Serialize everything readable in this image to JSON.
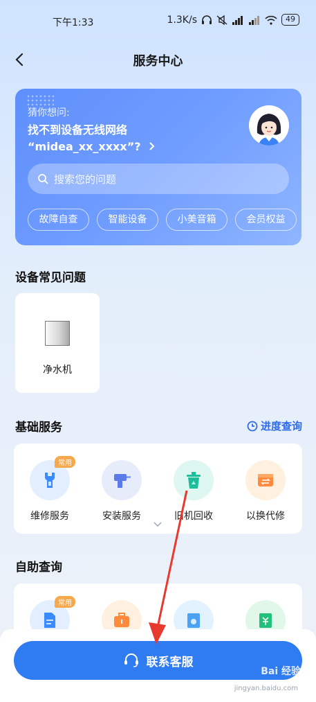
{
  "status_bar": {
    "time": "下午1:33",
    "speed": "1.3K/s",
    "battery": "49"
  },
  "header": {
    "title": "服务中心"
  },
  "hero": {
    "guess_label": "猜你想问:",
    "question_line1": "找不到设备无线网络",
    "question_line2": "“midea_xx_xxxx”?",
    "search_placeholder": "搜索您的问题",
    "chips": [
      "故障自查",
      "智能设备",
      "小美音箱",
      "会员权益"
    ]
  },
  "faq": {
    "title": "设备常见问题",
    "devices": [
      {
        "label": "净水机"
      }
    ]
  },
  "basic_services": {
    "title": "基础服务",
    "progress_link": "进度查询",
    "items": [
      {
        "label": "维修服务",
        "icon": "wrench-icon",
        "badge": "常用"
      },
      {
        "label": "安装服务",
        "icon": "drill-icon"
      },
      {
        "label": "旧机回收",
        "icon": "recycle-bin-icon"
      },
      {
        "label": "以换代修",
        "icon": "exchange-box-icon"
      }
    ]
  },
  "self_service": {
    "title": "自助查询",
    "items": [
      {
        "icon": "document-icon",
        "badge": "常用"
      },
      {
        "icon": "toolbox-icon"
      },
      {
        "icon": "part-icon"
      },
      {
        "icon": "price-icon"
      }
    ]
  },
  "contact_button": {
    "label": "联系客服"
  },
  "watermark": {
    "text": "Bai 经验",
    "sub": "jingyan.baidu.com"
  },
  "colors": {
    "primary": "#2f7bf2",
    "hero_start": "#5e8ffb",
    "hero_end": "#8fb6ff",
    "badge": "#f7a84a",
    "annotation_arrow": "#e8392f"
  }
}
